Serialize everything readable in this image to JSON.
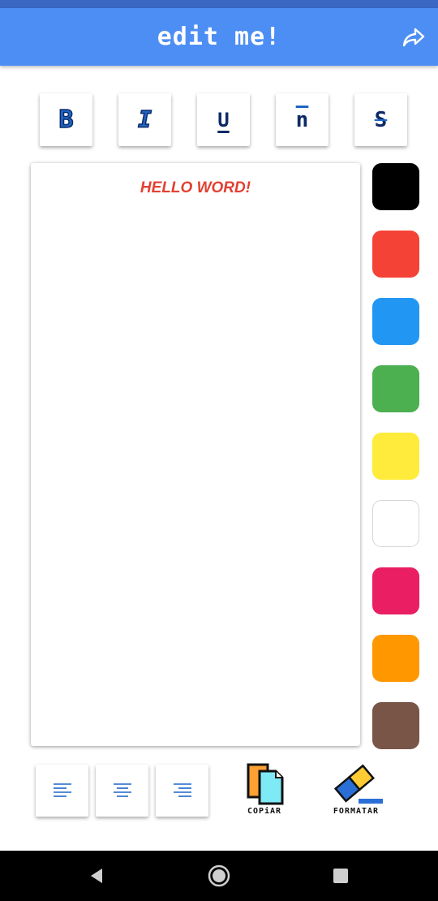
{
  "header": {
    "title": "edit me!",
    "share_icon": "share-icon"
  },
  "toolbar": {
    "buttons": [
      {
        "label": "B",
        "icon": "bold-icon"
      },
      {
        "label": "I",
        "icon": "italic-icon"
      },
      {
        "label": "U",
        "icon": "underline-icon"
      },
      {
        "label": "n",
        "icon": "overline-icon"
      },
      {
        "label": "S",
        "icon": "strikethrough-icon"
      }
    ]
  },
  "editor": {
    "text": "HELLO WORD!",
    "text_color": "#e24133"
  },
  "palette": {
    "colors": [
      "#000000",
      "#f44336",
      "#2196f3",
      "#4caf50",
      "#ffeb3b",
      "#ffffff",
      "#e91e63",
      "#ff9800",
      "#795548"
    ]
  },
  "bottom_tools": {
    "align_buttons": [
      "align-left-icon",
      "align-center-icon",
      "align-right-icon"
    ],
    "copy_label": "COPiAR",
    "format_label": "FORMATAR"
  },
  "accent_color": "#4d8ef5"
}
